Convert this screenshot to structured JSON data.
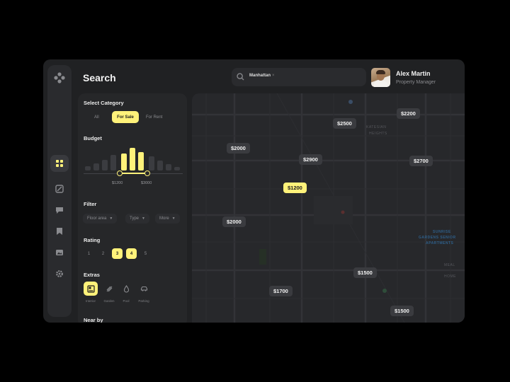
{
  "header": {
    "title": "Search"
  },
  "search": {
    "value": "Manhattan",
    "clear": "×"
  },
  "user": {
    "name": "Alex Martin",
    "role": "Property Manager"
  },
  "sidebar": {
    "items": [
      {
        "icon": "logo-icon"
      },
      {
        "icon": "grid-icon",
        "active": true
      },
      {
        "icon": "map-icon"
      },
      {
        "icon": "chat-icon"
      },
      {
        "icon": "bookmark-icon"
      },
      {
        "icon": "image-icon"
      },
      {
        "icon": "settings-icon"
      }
    ]
  },
  "filters": {
    "category": {
      "label": "Select Category",
      "options": [
        "All",
        "For Sale",
        "For Rent"
      ],
      "selected": "For Sale"
    },
    "budget": {
      "label": "Budget",
      "min_label": "$1200",
      "max_label": "$3000"
    },
    "filter": {
      "label": "Filter",
      "dropdowns": [
        "Floor area",
        "Type",
        "More"
      ]
    },
    "rating": {
      "label": "Rating",
      "options": [
        "1",
        "2",
        "3",
        "4",
        "5"
      ],
      "selected": [
        "3",
        "4"
      ]
    },
    "extras": {
      "label": "Extras",
      "items": [
        {
          "label": "Interior",
          "icon": "interior-icon",
          "active": true
        },
        {
          "label": "Garden",
          "icon": "garden-icon",
          "active": false
        },
        {
          "label": "Pool",
          "icon": "pool-icon",
          "active": false
        },
        {
          "label": "Parking",
          "icon": "car-icon",
          "active": false
        }
      ]
    },
    "nearby": {
      "label": "Near by"
    }
  },
  "map": {
    "pins": [
      {
        "price": "$2200"
      },
      {
        "price": "$2500"
      },
      {
        "price": "$2000"
      },
      {
        "price": "$2900"
      },
      {
        "price": "$2700"
      },
      {
        "price": "$1200",
        "active": true
      },
      {
        "price": "$2000"
      },
      {
        "price": "$1500"
      },
      {
        "price": "$1700"
      },
      {
        "price": "$1500"
      }
    ],
    "labels": {
      "district1": "KATESIAN",
      "district2": "HEIGHTS",
      "district3": "SUNRISE",
      "district4": "GARDENS SENIOR",
      "district5": "APARTMENTS",
      "district6": "MEAL",
      "district7": "HOME"
    }
  },
  "colors": {
    "accent": "#fff27a",
    "background": "#202123",
    "panel": "#262729"
  }
}
